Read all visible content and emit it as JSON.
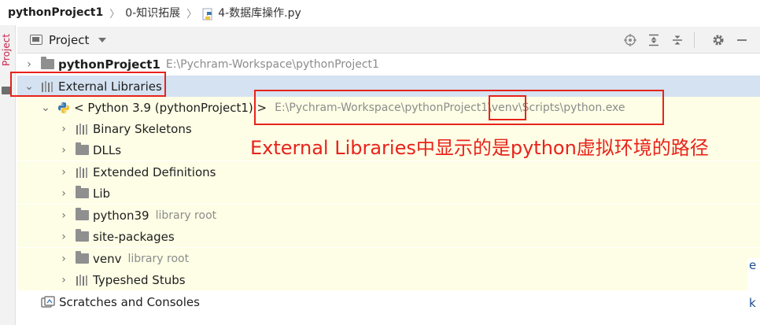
{
  "breadcrumb": {
    "project": "pythonProject1",
    "folder": "0-知识拓展",
    "file": "4-数据库操作.py"
  },
  "left_strip": {
    "label": "Project"
  },
  "panel": {
    "title": "Project",
    "tools": [
      "locate-icon",
      "expand-all-icon",
      "collapse-all-icon",
      "gear-icon",
      "minimize-icon"
    ]
  },
  "tree": {
    "project_row": {
      "name": "pythonProject1",
      "path": "E:\\Pychram-Workspace\\pythonProject1"
    },
    "external_libraries": {
      "name": "External Libraries"
    },
    "python_sdk": {
      "name": "< Python 3.9 (pythonProject1) >",
      "path": "E:\\Pychram-Workspace\\pythonProject1\\venv\\Scripts\\python.exe"
    },
    "children": [
      {
        "name": "Binary Skeletons",
        "icon": "library-icon",
        "note": ""
      },
      {
        "name": "DLLs",
        "icon": "folder-icon",
        "note": ""
      },
      {
        "name": "Extended Definitions",
        "icon": "library-icon",
        "note": ""
      },
      {
        "name": "Lib",
        "icon": "folder-icon",
        "note": ""
      },
      {
        "name": "python39",
        "icon": "folder-icon",
        "note": "library root"
      },
      {
        "name": "site-packages",
        "icon": "folder-icon",
        "note": ""
      },
      {
        "name": "venv",
        "icon": "folder-icon",
        "note": "library root"
      },
      {
        "name": "Typeshed Stubs",
        "icon": "library-icon",
        "note": ""
      }
    ],
    "scratches": {
      "name": "Scratches and Consoles"
    }
  },
  "annotation": {
    "text": "External Libraries中显示的是python虚拟环境的路径",
    "color": "#e8231b"
  },
  "right_clip": {
    "chars": [
      "e",
      "k"
    ]
  }
}
